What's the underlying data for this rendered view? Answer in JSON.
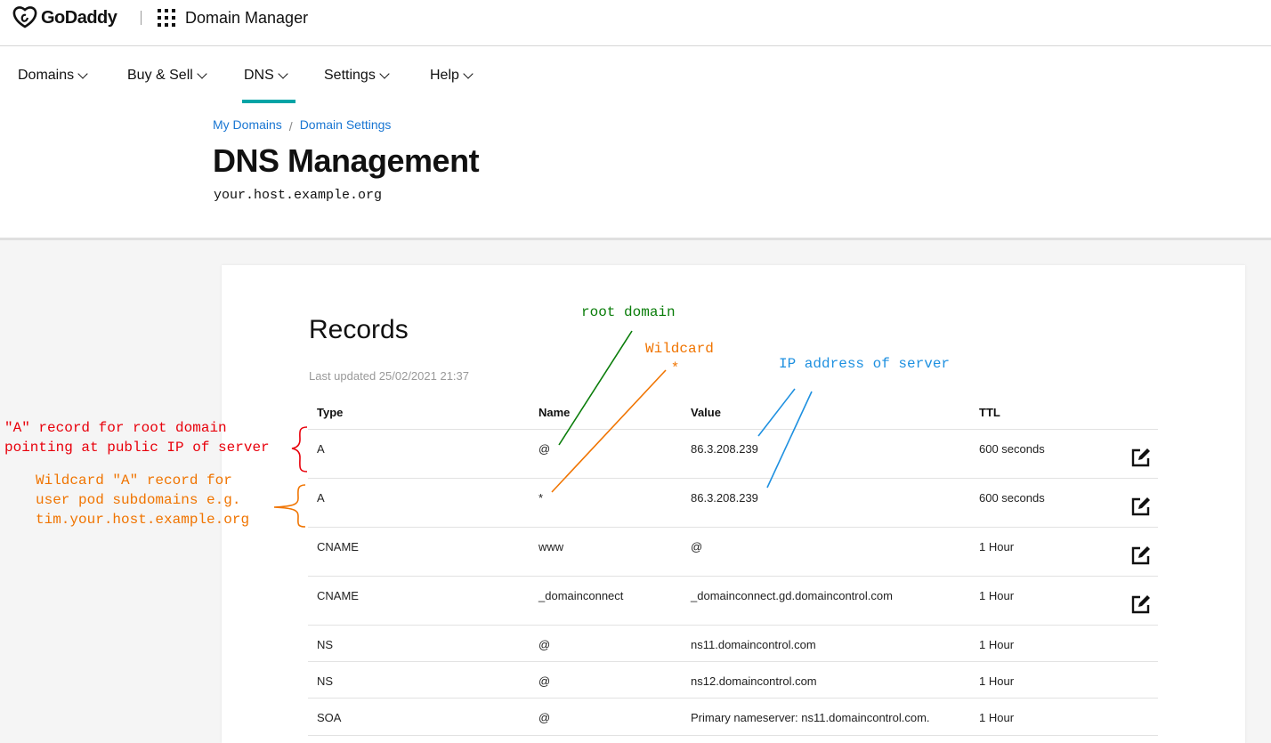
{
  "brand": {
    "logo_text": "GoDaddy",
    "app_title": "Domain Manager"
  },
  "nav": {
    "items": [
      {
        "label": "Domains"
      },
      {
        "label": "Buy & Sell"
      },
      {
        "label": "DNS"
      },
      {
        "label": "Settings"
      },
      {
        "label": "Help"
      }
    ],
    "active": "DNS",
    "accent_color": "#00a4a6"
  },
  "breadcrumb": {
    "items": [
      "My Domains",
      "Domain Settings"
    ],
    "separator": "/"
  },
  "page": {
    "title": "DNS Management",
    "host": "your.host.example.org"
  },
  "records": {
    "title": "Records",
    "last_updated": "Last updated 25/02/2021 21:37",
    "columns": {
      "type": "Type",
      "name": "Name",
      "value": "Value",
      "ttl": "TTL"
    },
    "rows": [
      {
        "type": "A",
        "name": "@",
        "value": "86.3.208.239",
        "ttl": "600 seconds",
        "editable": true
      },
      {
        "type": "A",
        "name": "*",
        "value": "86.3.208.239",
        "ttl": "600 seconds",
        "editable": true
      },
      {
        "type": "CNAME",
        "name": "www",
        "value": "@",
        "ttl": "1 Hour",
        "editable": true
      },
      {
        "type": "CNAME",
        "name": "_domainconnect",
        "value": "_domainconnect.gd.domaincontrol.com",
        "ttl": "1 Hour",
        "editable": true
      },
      {
        "type": "NS",
        "name": "@",
        "value": "ns11.domaincontrol.com",
        "ttl": "1 Hour",
        "editable": false
      },
      {
        "type": "NS",
        "name": "@",
        "value": "ns12.domaincontrol.com",
        "ttl": "1 Hour",
        "editable": false
      },
      {
        "type": "SOA",
        "name": "@",
        "value": "Primary nameserver: ns11.domaincontrol.com.",
        "ttl": "1 Hour",
        "editable": false
      }
    ]
  },
  "annotations": {
    "root_domain": "root domain",
    "wildcard": "Wildcard\n   *",
    "ip_address": "IP address of server",
    "a_record_root": "\"A\" record for root domain\npointing at public IP of server",
    "a_record_wildcard": "Wildcard \"A\" record for\nuser pod subdomains e.g.\ntim.your.host.example.org",
    "colors": {
      "red": "#e8000b",
      "orange": "#f07400",
      "green": "#0a7d0a",
      "blue": "#1e90e0"
    }
  }
}
